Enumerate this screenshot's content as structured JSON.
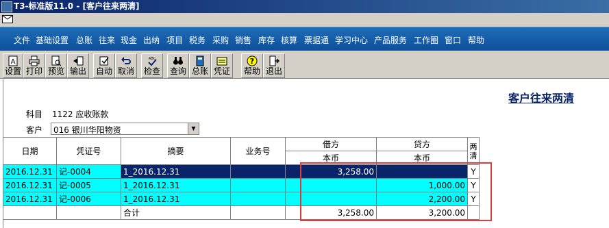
{
  "window": {
    "title": "T3-标准版11.0 - [客户往来两清]"
  },
  "menu": [
    "文件",
    "基础设置",
    "总账",
    "往来",
    "现金",
    "出纳",
    "项目",
    "税务",
    "采购",
    "销售",
    "库存",
    "核算",
    "票据通",
    "学习中心",
    "产品服务",
    "工作圈",
    "窗口",
    "帮助"
  ],
  "toolbar": {
    "buttons": [
      {
        "label": "设置",
        "icon": "setup-icon"
      },
      {
        "label": "打印",
        "icon": "print-icon"
      },
      {
        "label": "预览",
        "icon": "preview-icon"
      },
      {
        "label": "输出",
        "icon": "export-icon"
      },
      {
        "label": "自动",
        "icon": "auto-icon"
      },
      {
        "label": "取消",
        "icon": "undo-icon"
      },
      {
        "label": "检查",
        "icon": "check-icon"
      },
      {
        "label": "查询",
        "icon": "binoculars-icon"
      },
      {
        "label": "总账",
        "icon": "ledger-icon"
      },
      {
        "label": "凭证",
        "icon": "voucher-icon"
      },
      {
        "label": "帮助",
        "icon": "help-icon"
      },
      {
        "label": "退出",
        "icon": "exit-icon"
      }
    ]
  },
  "report": {
    "title": "客户往来两清",
    "subject_label": "科目",
    "subject_value": "1122 应收账款",
    "customer_label": "客户",
    "customer_value": "016  银川华阳物资"
  },
  "grid": {
    "headers": {
      "date": "日期",
      "voucher": "凭证号",
      "summary": "摘要",
      "business": "业务号",
      "debit": "借方",
      "credit": "贷方",
      "cleared": "两清",
      "currency_debit": "本币",
      "currency_credit": "本币"
    },
    "rows": [
      {
        "date": "2016.12.31",
        "voucher": "记-0004",
        "summary": "1_2016.12.31",
        "business": "",
        "debit": "3,258.00",
        "credit": "",
        "cleared": "Y"
      },
      {
        "date": "2016.12.31",
        "voucher": "记-0005",
        "summary": "1_2016.12.31",
        "business": "",
        "debit": "",
        "credit": "1,000.00",
        "cleared": "Y"
      },
      {
        "date": "2016.12.31",
        "voucher": "记-0006",
        "summary": "1_2016.12.31",
        "business": "",
        "debit": "",
        "credit": "2,200.00",
        "cleared": "Y"
      }
    ],
    "total": {
      "label": "合计",
      "debit": "3,258.00",
      "credit": "3,200.00"
    }
  },
  "colors": {
    "highlight": "#00ffff",
    "selected": "#0a246a",
    "annotation": "#e03c3c",
    "menubar": "#1f6db8"
  }
}
